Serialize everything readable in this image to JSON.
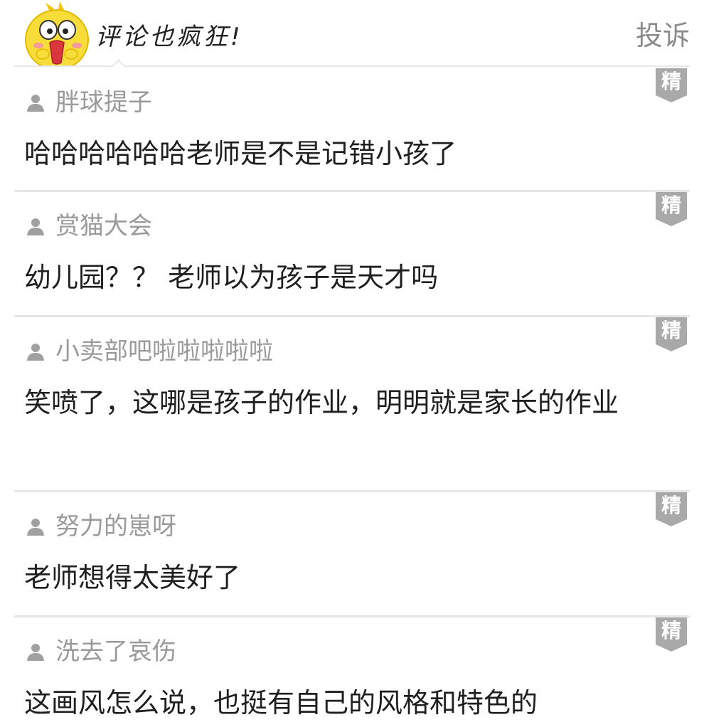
{
  "header": {
    "title": "评论也疯狂!",
    "report_label": "投诉",
    "mascot_icon": "yellow-chick-mascot-icon"
  },
  "badge_label": "精",
  "user_icon": "person-icon",
  "colors": {
    "badge": "#a9a9a9",
    "username": "#9a9a9a",
    "divider": "#e6e6e6",
    "mascot": "#f7dc3a"
  },
  "comments": [
    {
      "user": "胖球提子",
      "text": "哈哈哈哈哈哈老师是不是记错小孩了"
    },
    {
      "user": "赏猫大会",
      "text": "幼儿园？？ 老师以为孩子是天才吗"
    },
    {
      "user": "小卖部吧啦啦啦啦啦",
      "text": "笑喷了，这哪是孩子的作业，明明就是家长的作业"
    },
    {
      "user": "努力的崽呀",
      "text": "老师想得太美好了"
    },
    {
      "user": "洗去了哀伤",
      "text": "这画风怎么说，也挺有自己的风格和特色的"
    }
  ]
}
